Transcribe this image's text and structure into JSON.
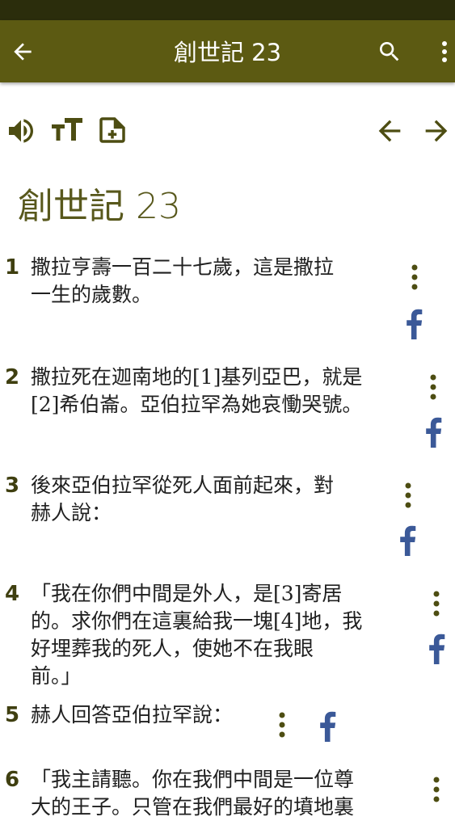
{
  "header": {
    "title": "創世記 23"
  },
  "toolbar": {
    "icons": [
      "speaker-icon",
      "text-size-icon",
      "add-note-icon",
      "arrow-left-icon",
      "arrow-right-icon"
    ]
  },
  "chapter": {
    "heading": "創世記 23"
  },
  "verses": [
    {
      "number": "1",
      "lines": [
        "撒拉亨壽一百二十七歲，這是撒拉",
        "一生的歲數。"
      ]
    },
    {
      "number": "2",
      "lines": [
        "撒拉死在迦南地的[1]基列亞巴，就是",
        "[2]希伯崙。亞伯拉罕為她哀慟哭號。"
      ]
    },
    {
      "number": "3",
      "lines": [
        "後來亞伯拉罕從死人面前起來，對",
        "赫人說："
      ]
    },
    {
      "number": "4",
      "lines": [
        "「我在你們中間是外人，是[3]寄居",
        "的。求你們在這裏給我一塊[4]地，我",
        "好埋葬我的死人，使她不在我眼",
        "前。」"
      ]
    },
    {
      "number": "5",
      "lines": [
        "赫人回答亞伯拉罕說："
      ]
    },
    {
      "number": "6",
      "lines": [
        "「我主請聽。你在我們中間是一位尊",
        "大的王子。只管在我們最好的墳地裏"
      ]
    }
  ],
  "colors": {
    "status_bar": "#2b2d0c",
    "app_bar": "#5c5a12",
    "icon": "#4d4d12",
    "facebook": "#3b5998"
  }
}
